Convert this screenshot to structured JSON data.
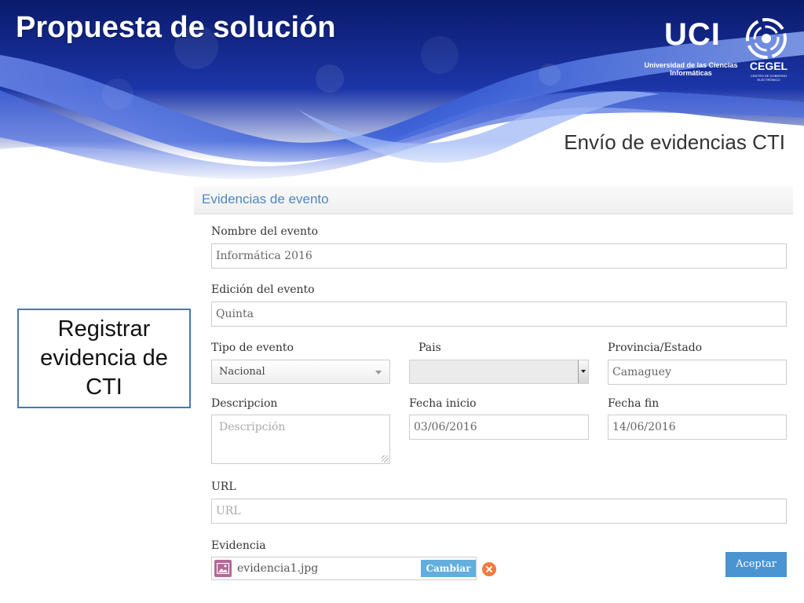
{
  "slide": {
    "title": "Propuesta de solución",
    "subtitle": "Envío de evidencias CTI",
    "logos": {
      "uci": {
        "mark": "UCI",
        "caption": "Universidad de las Ciencias Informáticas"
      },
      "cegel": {
        "mark": "CEGEL",
        "caption": "CENTRO DE GOBIERNO ELECTRÓNICO"
      }
    },
    "colors": {
      "banner_dark": "#0a1a6b",
      "banner_mid": "#2a4fc4",
      "callout_border": "#4a76b6"
    }
  },
  "callout": {
    "text": "Registrar evidencia de CTI"
  },
  "form": {
    "panel_title": "Evidencias de evento",
    "event_name": {
      "label": "Nombre del evento",
      "value": "Informática 2016"
    },
    "event_edition": {
      "label": "Edición del evento",
      "value": "Quinta"
    },
    "event_type": {
      "label": "Tipo de evento",
      "value": "Nacional"
    },
    "country": {
      "label": "Pais",
      "value": ""
    },
    "province": {
      "label": "Provincia/Estado",
      "value": "Camaguey"
    },
    "description": {
      "label": "Descripcion",
      "placeholder": "Descripción"
    },
    "start_date": {
      "label": "Fecha inicio",
      "value": "03/06/2016"
    },
    "end_date": {
      "label": "Fecha fin",
      "value": "14/06/2016"
    },
    "url": {
      "label": "URL",
      "placeholder": "URL"
    },
    "evidence": {
      "label": "Evidencia",
      "file_name": "evidencia1.jpg",
      "change_label": "Cambiar",
      "file_icon": "image-icon",
      "remove_icon": "close-icon"
    },
    "submit_label": "Aceptar",
    "colors": {
      "title": "#4d87bf",
      "accept_button": "#4b94d2",
      "change_button": "#63aedd",
      "remove_button": "#f07b3f",
      "file_icon_bg": "#b06b98"
    }
  }
}
